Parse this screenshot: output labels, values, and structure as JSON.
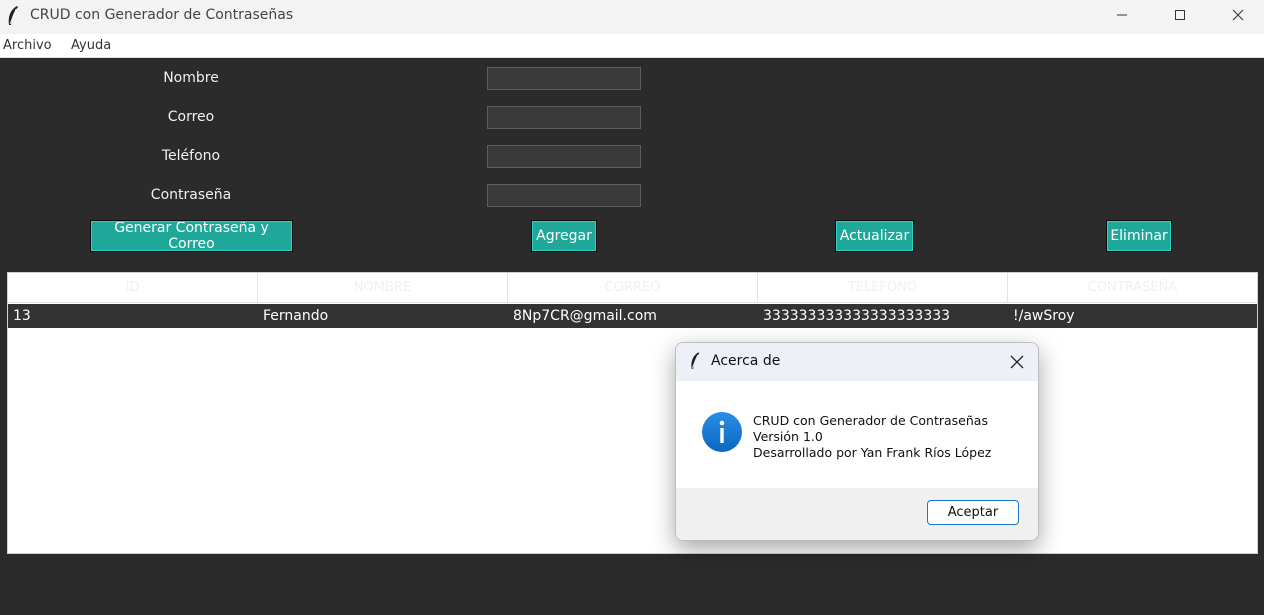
{
  "window": {
    "title": "CRUD con Generador de Contraseñas",
    "icon": "feather-icon"
  },
  "menu": {
    "items": [
      "Archivo",
      "Ayuda"
    ]
  },
  "form": {
    "fields": [
      {
        "label": "Nombre",
        "value": ""
      },
      {
        "label": "Correo",
        "value": ""
      },
      {
        "label": "Teléfono",
        "value": ""
      },
      {
        "label": "Contraseña",
        "value": ""
      }
    ],
    "buttons": {
      "generate": "Generar Contraseña y Correo",
      "add": "Agregar",
      "update": "Actualizar",
      "delete": "Eliminar"
    },
    "button_color": "#1fa89a"
  },
  "table": {
    "columns": [
      "ID",
      "NOMBRE",
      "CORREO",
      "TELEFONO",
      "CONTRASEÑA"
    ],
    "rows": [
      [
        "13",
        "Fernando",
        "8Np7CR@gmail.com",
        "333333333333333333333",
        "!/awSroy"
      ]
    ]
  },
  "dialog": {
    "title": "Acerca de",
    "icon": "info-icon",
    "lines": [
      "CRUD con Generador de Contraseñas",
      "Versión 1.0",
      "Desarrollado por Yan Frank Ríos López"
    ],
    "ok_label": "Aceptar"
  }
}
